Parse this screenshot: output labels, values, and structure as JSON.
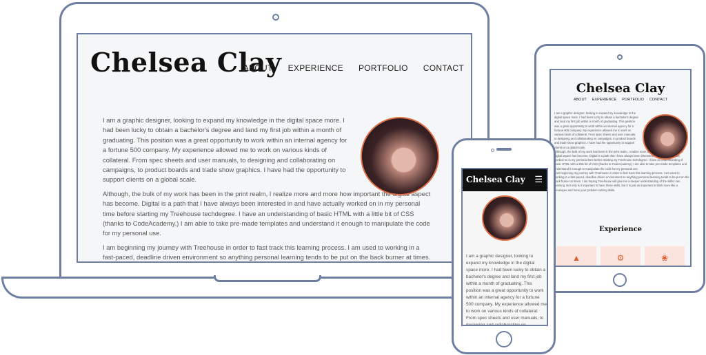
{
  "site": {
    "name": "Chelsea Clay",
    "nav": [
      "ABOUT",
      "EXPERIENCE",
      "PORTFOLIO",
      "CONTACT"
    ]
  },
  "about": {
    "p1": "I am a graphic designer, looking to expand my knowledge in the digital space more. I had been lucky to obtain a bachelor's degree and land my first job within a month of graduating. This position was a great opportunity to work within an internal agency for a fortune 500 company. My experience allowed me to work on various kinds of collateral. From spec sheets and user manuals, to designing and collaborating on campaigns, to product boards and trade show graphics. I have had the opportunity to support clients on a global scale.",
    "p2": "Although, the bulk of my work has been in the print realm, I realize more and more how important the digital aspect has become. Digital is a path that I have always been interested in and have actually worked on in my personal time before starting my Treehouse techdegree. I have an understanding of basic HTML with a little bit of CSS (thanks to CodeAcademy.) I am able to take pre-made templates and understand it enough to manipulate the code for my personal use.",
    "p3": "I am beginning my journey with Treehouse in order to fast track this learning process. I am used to working in a fast-paced, deadline driven environment so anything personal learning tends to be put on the back burner at times. I am hoping Treehouse will give me a deeper understanding of the skills I am learning. Not only is it important to have these skills, but it is just as important to think more like a developer and hone your problem solving skills."
  },
  "tablet": {
    "section_title": "Experience"
  },
  "phone": {
    "menu_icon": "hamburger-icon",
    "body": "I am a graphic designer, looking to expand my knowledge in the digital space more. I had been lucky to obtain a bachelor's degree and land my first job within a month of graduating. This position was a great opportunity to work within an internal agency for a fortune 500 company. My experience allowed me to work on various kinds of collateral. From spec sheets and user manuals, to designing and collaborating on"
  },
  "colors": {
    "accent": "#e0704a",
    "device_outline": "#6d7ea1",
    "card_bg": "#fbe3de"
  }
}
